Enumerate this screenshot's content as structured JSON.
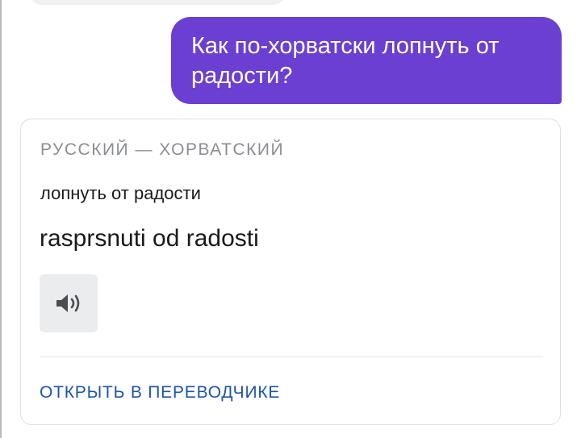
{
  "chat": {
    "user_message": "Как по-хорватски лопнуть от радости?"
  },
  "translation_card": {
    "language_pair": "РУССКИЙ — ХОРВАТСКИЙ",
    "source_text": "лопнуть от радости",
    "translated_text": "rasprsnuti od radosti",
    "speak_icon": "speaker-icon",
    "open_link_label": "ОТКРЫТЬ В ПЕРЕВОДЧИКЕ"
  },
  "colors": {
    "user_bubble": "#6a3fd1",
    "link": "#1d55a9",
    "muted_text": "#8a8d91",
    "speak_button_bg": "#eaecee"
  }
}
